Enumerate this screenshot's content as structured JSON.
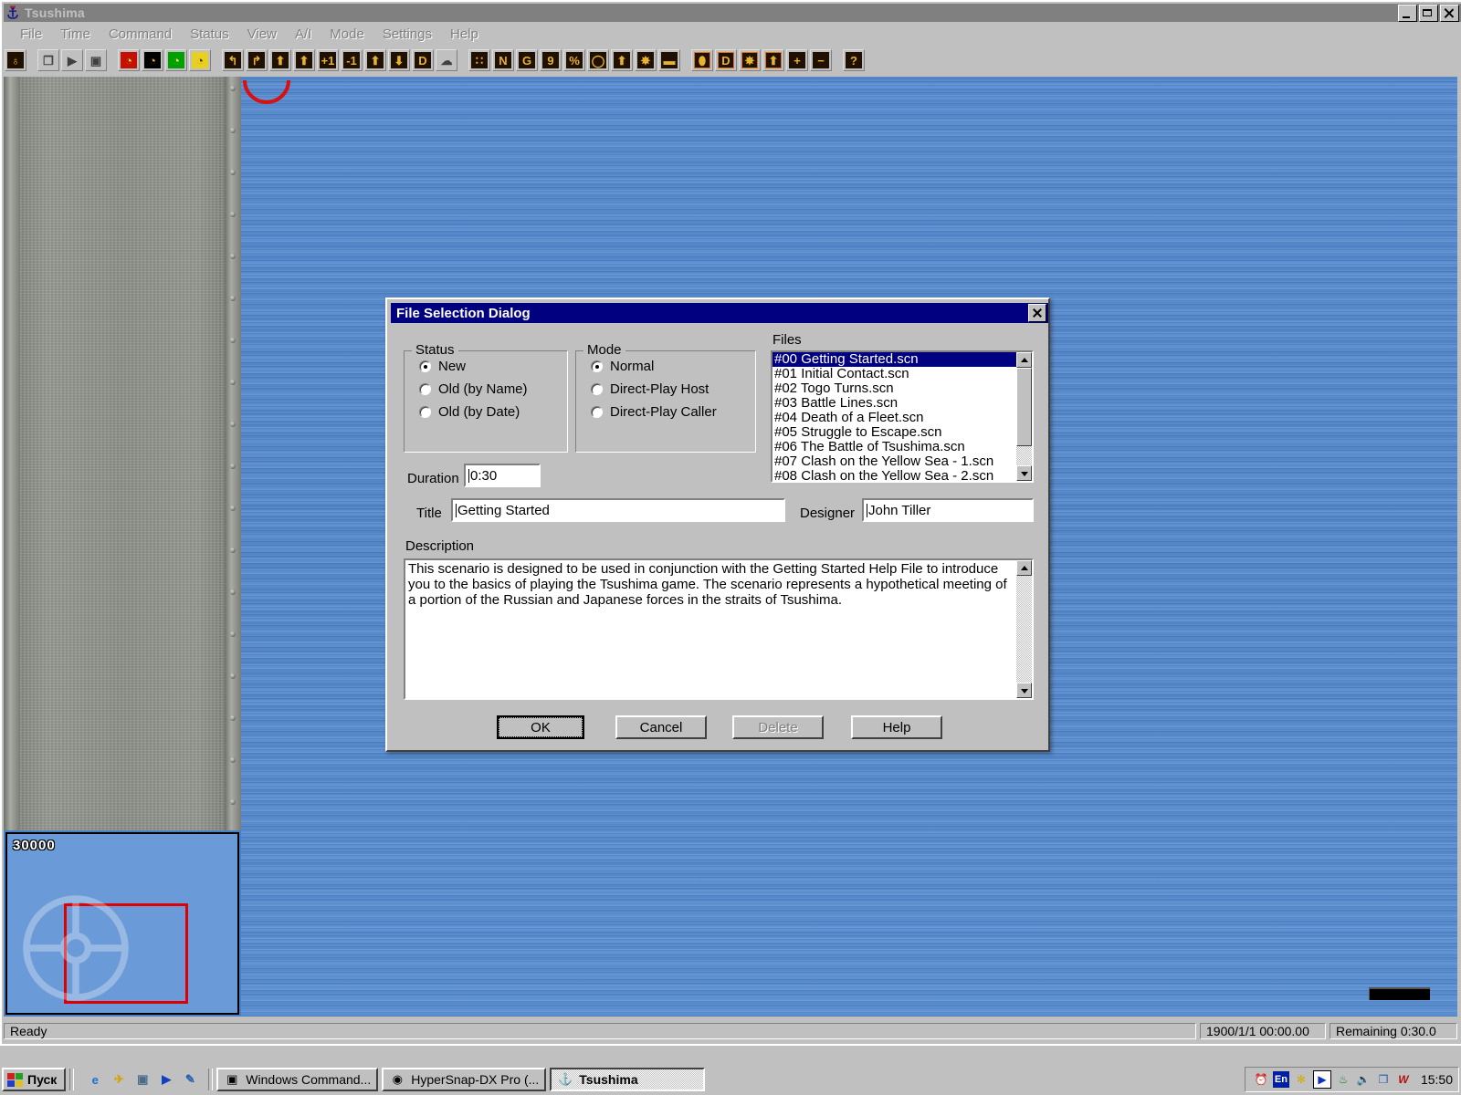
{
  "window": {
    "title": "Tsushima",
    "icon": "anchor-icon",
    "controls": [
      {
        "name": "minimize-button",
        "glyph": "minimize-icon"
      },
      {
        "name": "restore-button",
        "glyph": "restore-icon"
      },
      {
        "name": "close-button",
        "glyph": "close-icon"
      }
    ]
  },
  "menubar": {
    "items": [
      {
        "label": "File"
      },
      {
        "label": "Time"
      },
      {
        "label": "Command"
      },
      {
        "label": "Status"
      },
      {
        "label": "View"
      },
      {
        "label": "A/I"
      },
      {
        "label": "Mode"
      },
      {
        "label": "Settings"
      },
      {
        "label": "Help"
      }
    ]
  },
  "toolbar": {
    "groups": [
      {
        "buttons": [
          {
            "name": "target-scope-button",
            "icon": "crosshair-icon",
            "glyph": "♁",
            "style": "dark"
          }
        ]
      },
      {
        "buttons": [
          {
            "name": "new-file-button",
            "icon": "new-document-icon",
            "glyph": "❐",
            "style": "gray"
          },
          {
            "name": "open-file-button",
            "icon": "open-folder-icon",
            "glyph": "▶",
            "style": "gray"
          },
          {
            "name": "save-file-button",
            "icon": "floppy-disk-icon",
            "glyph": "▣",
            "style": "gray"
          }
        ]
      },
      {
        "buttons": [
          {
            "name": "clock-red-button",
            "icon": "clock-red-icon",
            "glyph": "◔",
            "style": "red"
          },
          {
            "name": "clock-black-button",
            "icon": "clock-black-icon",
            "glyph": "◔",
            "style": "black"
          },
          {
            "name": "clock-green-button",
            "icon": "clock-green-icon",
            "glyph": "◔",
            "style": "green"
          },
          {
            "name": "clock-yellow-button",
            "icon": "clock-yellow-icon",
            "glyph": "◔",
            "style": "yellow"
          }
        ]
      },
      {
        "buttons": [
          {
            "name": "turn-left-button",
            "icon": "turn-left-arrow-icon",
            "glyph": "↰",
            "style": "dark"
          },
          {
            "name": "turn-right-button",
            "icon": "turn-right-arrow-icon",
            "glyph": "↱",
            "style": "dark"
          },
          {
            "name": "formation-left-button",
            "icon": "formation-left-icon",
            "glyph": "⬆",
            "style": "dark"
          },
          {
            "name": "formation-right-button",
            "icon": "formation-right-icon",
            "glyph": "⬆",
            "style": "dark"
          },
          {
            "name": "speed-up-button",
            "icon": "plus-one-icon",
            "glyph": "+1",
            "style": "dark"
          },
          {
            "name": "speed-down-button",
            "icon": "minus-one-icon",
            "glyph": "-1",
            "style": "dark"
          },
          {
            "name": "raise-button",
            "icon": "up-arrow-icon",
            "glyph": "⬆",
            "style": "dark"
          },
          {
            "name": "lower-button",
            "icon": "down-arrow-icon",
            "glyph": "⬇",
            "style": "dark"
          },
          {
            "name": "damage-button",
            "icon": "letter-d-icon",
            "glyph": "D",
            "style": "dark"
          },
          {
            "name": "smoke-button",
            "icon": "smoke-cloud-icon",
            "glyph": "☁",
            "style": "gray"
          }
        ]
      },
      {
        "buttons": [
          {
            "name": "dots-button",
            "icon": "dot-grid-icon",
            "glyph": "∷",
            "style": "dark"
          },
          {
            "name": "names-button",
            "icon": "letter-n-icon",
            "glyph": "N",
            "style": "dark"
          },
          {
            "name": "grid-button",
            "icon": "letter-g-icon",
            "glyph": "G",
            "style": "dark"
          },
          {
            "name": "nine-button",
            "icon": "digit-nine-icon",
            "glyph": "9",
            "style": "dark"
          },
          {
            "name": "percent-button",
            "icon": "percent-icon",
            "glyph": "%",
            "style": "dark"
          },
          {
            "name": "circle-button",
            "icon": "circle-outline-icon",
            "glyph": "◯",
            "style": "dark"
          },
          {
            "name": "arrow-up-button",
            "icon": "solid-up-arrow-icon",
            "glyph": "⬆",
            "style": "dark"
          },
          {
            "name": "explosion-button",
            "icon": "explosion-icon",
            "glyph": "✸",
            "style": "dark"
          },
          {
            "name": "torpedo-button",
            "icon": "torpedo-icon",
            "glyph": "▬",
            "style": "dark"
          }
        ]
      },
      {
        "buttons": [
          {
            "name": "ship-view-button",
            "icon": "ship-silhouette-icon",
            "glyph": "⬮",
            "style": "orange-f"
          },
          {
            "name": "damage-view-button",
            "icon": "letter-d-outline-icon",
            "glyph": "D",
            "style": "orange-f"
          },
          {
            "name": "hit-view-button",
            "icon": "explosion-hit-icon",
            "glyph": "✸",
            "style": "orange-f"
          },
          {
            "name": "move-view-button",
            "icon": "up-arrow-outline-icon",
            "glyph": "⬆",
            "style": "orange-f"
          },
          {
            "name": "zoom-in-button",
            "icon": "plus-icon",
            "glyph": "+",
            "style": "dark"
          },
          {
            "name": "zoom-out-button",
            "icon": "minus-icon",
            "glyph": "−",
            "style": "dark"
          }
        ]
      },
      {
        "buttons": [
          {
            "name": "help-button",
            "icon": "question-mark-icon",
            "glyph": "?",
            "style": "dark"
          }
        ]
      }
    ]
  },
  "minimap": {
    "scale_label": "30000",
    "viewport_rect_color": "#e00000"
  },
  "statusbar": {
    "ready": "Ready",
    "datetime": "1900/1/1 00:00.00",
    "remaining": "Remaining 0:30.0"
  },
  "dialog": {
    "title": "File Selection Dialog",
    "close_icon": "close-icon",
    "status_group": {
      "legend": "Status",
      "options": [
        {
          "label": "New",
          "selected": true
        },
        {
          "label": "Old (by Name)",
          "selected": false
        },
        {
          "label": "Old (by Date)",
          "selected": false
        }
      ]
    },
    "mode_group": {
      "legend": "Mode",
      "options": [
        {
          "label": "Normal",
          "selected": true
        },
        {
          "label": "Direct-Play Host",
          "selected": false
        },
        {
          "label": "Direct-Play Caller",
          "selected": false
        }
      ]
    },
    "duration": {
      "label": "Duration",
      "value": "0:30"
    },
    "files": {
      "label": "Files",
      "items": [
        {
          "name": "#00 Getting Started.scn",
          "selected": true
        },
        {
          "name": "#01 Initial Contact.scn",
          "selected": false
        },
        {
          "name": "#02 Togo Turns.scn",
          "selected": false
        },
        {
          "name": "#03 Battle Lines.scn",
          "selected": false
        },
        {
          "name": "#04 Death of a Fleet.scn",
          "selected": false
        },
        {
          "name": "#05 Struggle to Escape.scn",
          "selected": false
        },
        {
          "name": "#06 The Battle of Tsushima.scn",
          "selected": false
        },
        {
          "name": "#07 Clash on the Yellow Sea - 1.scn",
          "selected": false
        },
        {
          "name": "#08 Clash on the Yellow Sea - 2.scn",
          "selected": false
        }
      ]
    },
    "title_field": {
      "label": "Title",
      "value": "Getting Started"
    },
    "designer_field": {
      "label": "Designer",
      "value": "John Tiller"
    },
    "description": {
      "label": "Description",
      "text": "This scenario is designed to be used in conjunction with the Getting Started Help File to introduce you to the basics of playing the Tsushima game.  The scenario represents a hypothetical meeting of a portion of the Russian and Japanese forces in the straits of Tsushima."
    },
    "buttons": [
      {
        "label": "OK",
        "name": "ok-button",
        "state": "focused"
      },
      {
        "label": "Cancel",
        "name": "cancel-button",
        "state": "normal"
      },
      {
        "label": "Delete",
        "name": "delete-button",
        "state": "disabled"
      },
      {
        "label": "Help",
        "name": "help-button",
        "state": "normal"
      }
    ]
  },
  "taskbar": {
    "start_label": "Пуск",
    "quick_launch": [
      {
        "name": "internet-explorer-icon",
        "glyph": "e",
        "color": "#1a6fd4"
      },
      {
        "name": "outlook-express-icon",
        "glyph": "✈",
        "color": "#d8a000"
      },
      {
        "name": "show-desktop-icon",
        "glyph": "▣",
        "color": "#4a6a8a"
      },
      {
        "name": "media-player-icon",
        "glyph": "▶",
        "color": "#1040c0"
      },
      {
        "name": "notepad-edit-icon",
        "glyph": "✎",
        "color": "#2060b0"
      }
    ],
    "tasks": [
      {
        "label": "Windows Command...",
        "icon": "floppy-disk-icon",
        "glyph": "▣",
        "active": false
      },
      {
        "label": "HyperSnap-DX Pro (...",
        "icon": "camera-icon",
        "glyph": "◉",
        "active": false
      },
      {
        "label": "Tsushima",
        "icon": "anchor-icon",
        "glyph": "⚓",
        "active": true
      }
    ],
    "tray": [
      {
        "name": "scheduled-tasks-icon",
        "glyph": "⏰"
      },
      {
        "name": "language-indicator-icon",
        "glyph": "En"
      },
      {
        "name": "gear-cluster-icon",
        "glyph": "✻"
      },
      {
        "name": "media-play-icon",
        "glyph": "▶"
      },
      {
        "name": "network-icon",
        "glyph": "⚇"
      },
      {
        "name": "volume-icon",
        "glyph": "ὐA"
      },
      {
        "name": "display-properties-icon",
        "glyph": "❐"
      },
      {
        "name": "word-icon",
        "glyph": "W"
      }
    ],
    "clock": "15:50"
  }
}
